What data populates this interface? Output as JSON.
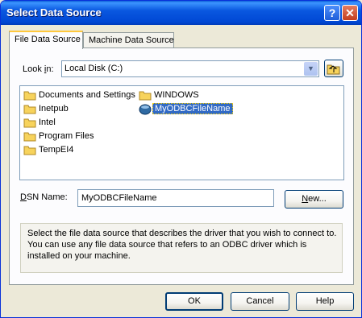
{
  "window": {
    "title": "Select Data Source",
    "help_glyph": "?",
    "close_glyph": "✕"
  },
  "tabs": [
    {
      "label": "File Data Source",
      "active": true
    },
    {
      "label": "Machine Data Source",
      "active": false
    }
  ],
  "look_in": {
    "label_prefix": "Look ",
    "label_u": "i",
    "label_suffix": "n:",
    "value": "Local Disk (C:)"
  },
  "files": [
    {
      "name": "Documents and Settings",
      "type": "folder"
    },
    {
      "name": "Inetpub",
      "type": "folder"
    },
    {
      "name": "Intel",
      "type": "folder"
    },
    {
      "name": "Program Files",
      "type": "folder"
    },
    {
      "name": "TempEI4",
      "type": "folder"
    },
    {
      "name": "WINDOWS",
      "type": "folder"
    },
    {
      "name": "MyODBCFileName",
      "type": "dsn",
      "selected": true
    }
  ],
  "dsn": {
    "label_u": "D",
    "label_rest": "SN Name:",
    "value": "MyODBCFileName"
  },
  "new_button": {
    "label_u": "N",
    "label_rest": "ew..."
  },
  "description": "Select the file data source that describes the driver that you wish to connect to. You can use any file data source that refers to an ODBC driver which is installed on your machine.",
  "buttons": {
    "ok": "OK",
    "cancel": "Cancel",
    "help": "Help"
  },
  "colors": {
    "title_bar": "#0a58e0",
    "selection": "#316ac5",
    "folder": "#f7d35c"
  }
}
